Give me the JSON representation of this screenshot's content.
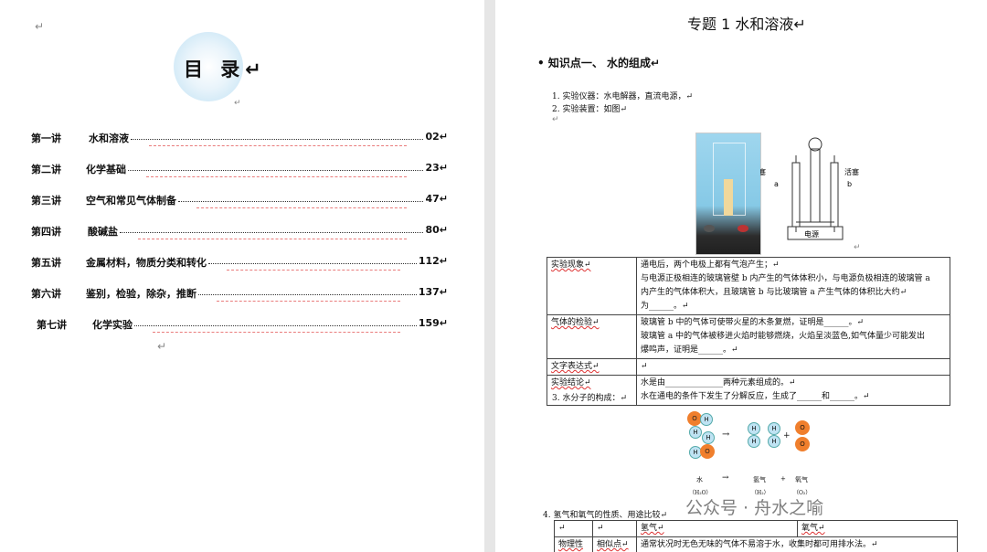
{
  "toc": {
    "title": "目 录↵",
    "items": [
      {
        "lecture": "第一讲",
        "title": "水和溶液",
        "page": "02↵"
      },
      {
        "lecture": "第二讲",
        "title": "化学基础",
        "page": "23↵"
      },
      {
        "lecture": "第三讲",
        "title": "空气和常见气体制备",
        "page": "47↵"
      },
      {
        "lecture": "第四讲",
        "title": "酸碱盐",
        "page": "80↵"
      },
      {
        "lecture": "第五讲",
        "title": "金属材料，物质分类和转化",
        "page": "112↵"
      },
      {
        "lecture": "第六讲",
        "title": "鉴别，检验，除杂，推断",
        "page": "137↵"
      },
      {
        "lecture": "第七讲",
        "title": "化学实验",
        "page": "159↵"
      }
    ]
  },
  "doc": {
    "title": "专题 1    水和溶液↵",
    "knowledge_point": "• 知识点一、  水的组成↵",
    "item1": "1. 实验仪器：水电解器，直流电源，↵",
    "item2": "2. 实验装置：如图↵",
    "figure_labels": {
      "valve_left": "活塞",
      "valve_right": "活塞",
      "a": "a",
      "b": "b",
      "power": "电源"
    },
    "table1": [
      {
        "head": "实验现象↵",
        "lines": [
          "通电后，两个电极上都有气泡产生；↵",
          "与电源正极相连的玻璃管壁 b 内产生的气体体积小，与电源负极相连的玻璃管 a",
          "内产生的气体体积大，且玻璃管 b 与比玻璃管 a 产生气体的体积比大约↵",
          "为______。↵"
        ]
      },
      {
        "head": "气体的检验↵",
        "lines": [
          "玻璃管 b 中的气体可使带火星的木条复燃，证明是______。↵",
          "玻璃管 a 中的气体被移进火焰时能够燃烧，火焰呈淡蓝色,如气体量少可能发出",
          "爆鸣声，证明是______。↵"
        ]
      },
      {
        "head": "文字表达式↵",
        "lines": [
          "↵"
        ]
      },
      {
        "head": "实验结论↵",
        "lines": [
          "水是由______________两种元素组成的。↵",
          "水在通电的条件下发生了分解反应，生成了______和______。↵"
        ]
      }
    ],
    "item3": "3. 水分子的构成：↵",
    "molecule_labels": {
      "water": "水",
      "water_f": "（H₂O）",
      "arrow": "→",
      "h2": "氢气",
      "h2_f": "（H₂）",
      "plus": "+",
      "o2": "氧气",
      "o2_f": "（O₂）",
      "H": "H",
      "O": "O"
    },
    "item4": "4.   氢气和氧气的性质、用途比较↵",
    "table2": {
      "header": [
        "↵",
        "↵",
        "氢气↵",
        "氧气↵"
      ],
      "row1_head": "物理性",
      "row1_sub": "相似点↵",
      "row1_text": "通常状况时无色无味的气体不易溶于水，收集时都可用排水法。↵"
    }
  },
  "watermark": "公众号 · 舟水之喻"
}
